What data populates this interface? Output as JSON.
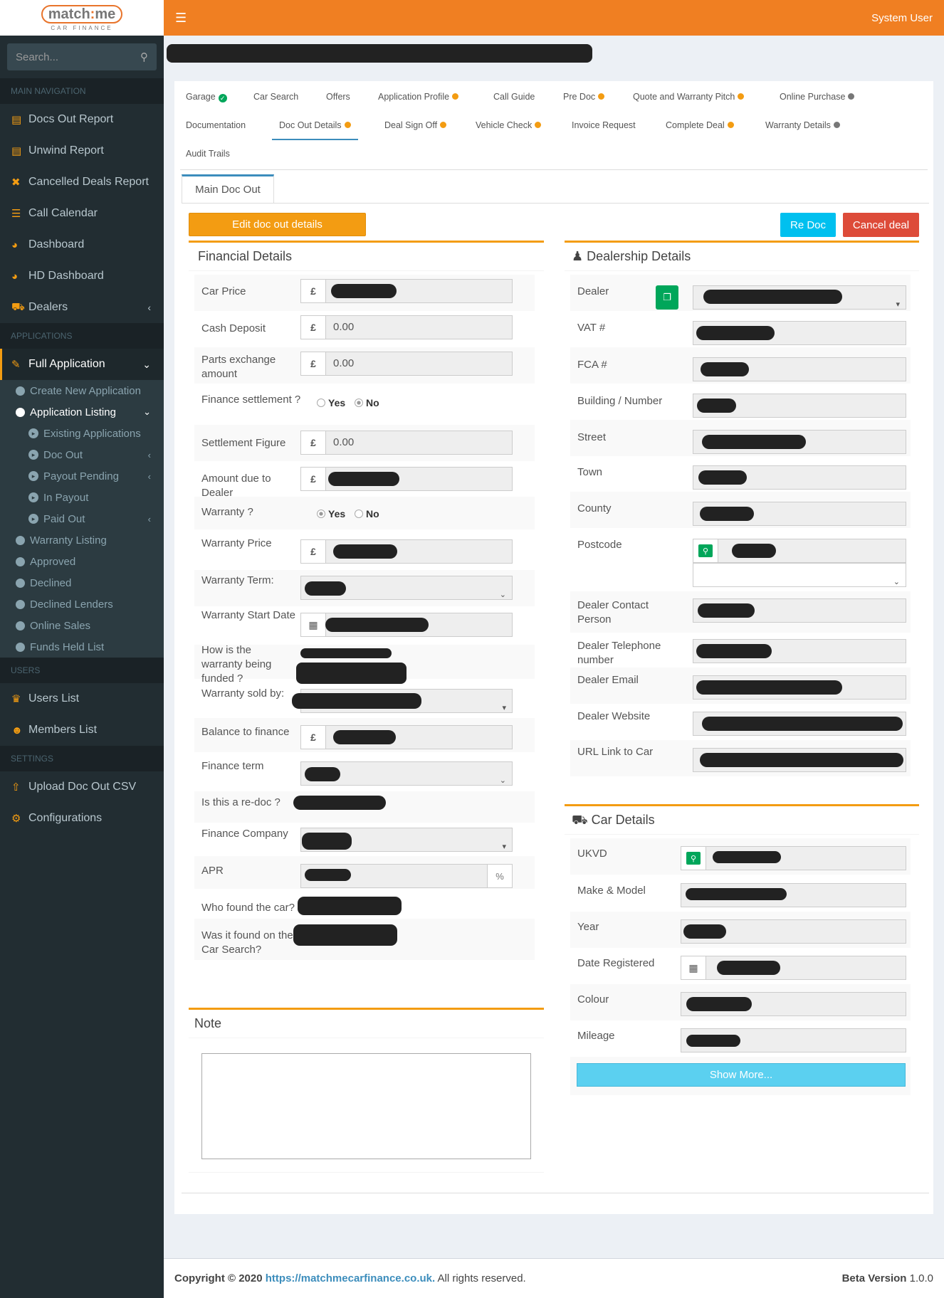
{
  "logo": {
    "brand_left": "match",
    "brand_colon": ":",
    "brand_right": "me",
    "tagline": "CAR FINANCE"
  },
  "sidebar": {
    "search_placeholder": "Search...",
    "sections": {
      "main": "MAIN NAVIGATION",
      "applications": "APPLICATIONS",
      "users": "USERS",
      "settings": "SETTINGS"
    },
    "main_items": [
      "Docs Out Report",
      "Unwind Report",
      "Cancelled Deals Report",
      "Call Calendar",
      "Dashboard",
      "HD Dashboard",
      "Dealers"
    ],
    "full_application": "Full Application",
    "app_sub": [
      "Create New Application",
      "Application Listing"
    ],
    "listing_sub": [
      "Existing Applications",
      "Doc Out",
      "Payout Pending",
      "In Payout",
      "Paid Out"
    ],
    "app_sub2": [
      "Warranty Listing",
      "Approved",
      "Declined",
      "Declined Lenders",
      "Online Sales",
      "Funds Held List"
    ],
    "user_items": [
      "Users List",
      "Members List"
    ],
    "setting_items": [
      "Upload Doc Out CSV",
      "Configurations"
    ]
  },
  "header": {
    "user": "System User"
  },
  "tabs": [
    "Garage",
    "Car Search",
    "Offers",
    "Application Profile",
    "Call Guide",
    "Pre Doc",
    "Quote and Warranty Pitch",
    "Online Purchase",
    "Documentation",
    "Doc Out Details",
    "Deal Sign Off",
    "Vehicle Check",
    "Invoice Request",
    "Complete Deal",
    "Warranty Details",
    "Audit Trails"
  ],
  "subtab": "Main Doc Out",
  "buttons": {
    "edit": "Edit doc out details",
    "redoc": "Re Doc",
    "cancel": "Cancel deal",
    "show_more": "Show More..."
  },
  "financial": {
    "title": "Financial Details",
    "currency": "£",
    "labels": {
      "car_price": "Car Price",
      "cash_deposit": "Cash Deposit",
      "parts_exchange": "Parts exchange amount",
      "finance_settlement": "Finance settlement ?",
      "settlement_figure": "Settlement Figure",
      "amount_due": "Amount due to Dealer",
      "warranty": "Warranty ?",
      "warranty_price": "Warranty Price",
      "warranty_term": "Warranty Term:",
      "warranty_start": "Warranty Start Date",
      "warranty_funded": "How is the warranty being funded ?",
      "warranty_sold_by": "Warranty sold by:",
      "balance": "Balance to finance",
      "finance_term": "Finance term",
      "redoc": "Is this a re-doc ?",
      "finance_company": "Finance Company",
      "apr": "APR",
      "who_found": "Who found the car?",
      "found_on_search": "Was it found on the Car Search?"
    },
    "values": {
      "cash_deposit": "0.00",
      "parts_exchange": "0.00",
      "settlement_figure": "0.00"
    },
    "yes": "Yes",
    "no": "No",
    "percent": "%"
  },
  "note": {
    "title": "Note"
  },
  "dealership": {
    "title": "Dealership Details",
    "labels": [
      "Dealer",
      "VAT #",
      "FCA #",
      "Building / Number",
      "Street",
      "Town",
      "County",
      "Postcode",
      "Dealer Contact Person",
      "Dealer Telephone number",
      "Dealer Email",
      "Dealer Website",
      "URL Link to Car"
    ]
  },
  "car": {
    "title": "Car Details",
    "labels": [
      "UKVD",
      "Make & Model",
      "Year",
      "Date Registered",
      "Colour",
      "Mileage"
    ]
  },
  "footer": {
    "copyright": "Copyright © 2020",
    "link": "https://matchmecarfinance.co.uk.",
    "rights": "All rights reserved.",
    "beta_label": "Beta Version",
    "version": "1.0.0"
  }
}
